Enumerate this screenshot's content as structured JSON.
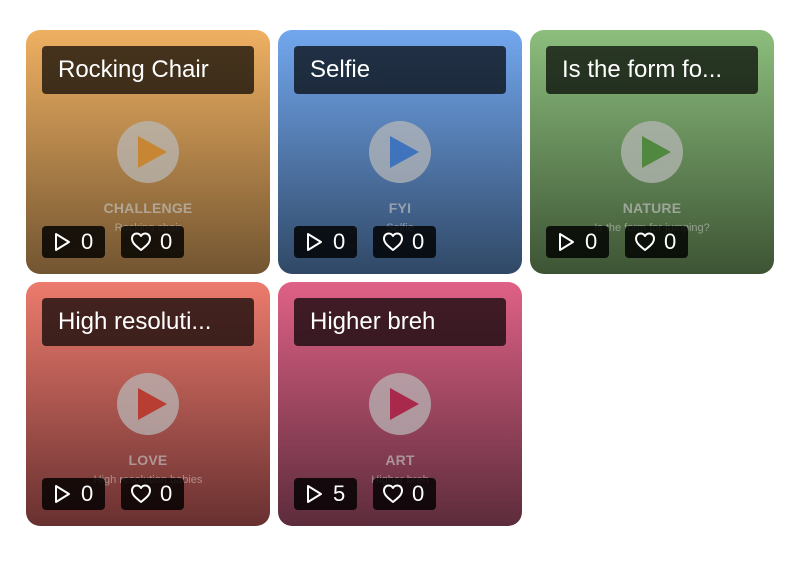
{
  "cards": [
    {
      "title": "Rocking Chair",
      "category": "CHALLENGE",
      "subtitle": "Rocking chair",
      "plays": "0",
      "likes": "0",
      "gradient_top": "#efb062",
      "gradient_bottom": "#725531",
      "accent": "#c68634"
    },
    {
      "title": "Selfie",
      "category": "FYI",
      "subtitle": "Selfie",
      "plays": "0",
      "likes": "0",
      "gradient_top": "#72a7ee",
      "gradient_bottom": "#304866",
      "accent": "#3f73bb"
    },
    {
      "title": "Is the form fo...",
      "category": "NATURE",
      "subtitle": "Is the form for jumping?",
      "plays": "0",
      "likes": "0",
      "gradient_top": "#8cbe7d",
      "gradient_bottom": "#3d5434",
      "accent": "#51883f"
    },
    {
      "title": "High resoluti...",
      "category": "LOVE",
      "subtitle": "High resolution babies",
      "plays": "0",
      "likes": "0",
      "gradient_top": "#ec7b6d",
      "gradient_bottom": "#683030",
      "accent": "#b83e33"
    },
    {
      "title": "Higher breh",
      "category": "ART",
      "subtitle": "Higher breh",
      "plays": "5",
      "likes": "0",
      "gradient_top": "#df6186",
      "gradient_bottom": "#5c2c3b",
      "accent": "#a9294d"
    }
  ],
  "icons": {
    "play": "play-icon",
    "plays": "play-outline-icon",
    "likes": "heart-outline-icon"
  }
}
